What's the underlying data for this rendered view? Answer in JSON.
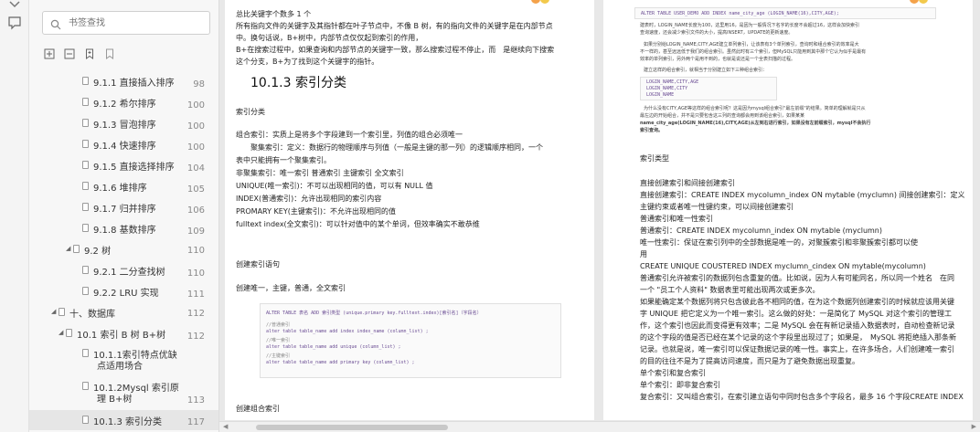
{
  "outline": {
    "search_placeholder": "书签查找",
    "items": [
      {
        "label": "9.1.1 直接插入排序",
        "page": "98",
        "level": 2
      },
      {
        "label": "9.1.2 希尔排序",
        "page": "100",
        "level": 2
      },
      {
        "label": "9.1.3 冒泡排序",
        "page": "100",
        "level": 2
      },
      {
        "label": "9.1.4 快速排序",
        "page": "100",
        "level": 2
      },
      {
        "label": "9.1.5 直接选择排序",
        "page": "104",
        "level": 2
      },
      {
        "label": "9.1.6 堆排序",
        "page": "105",
        "level": 2
      },
      {
        "label": "9.1.7 归并排序",
        "page": "106",
        "level": 2
      },
      {
        "label": "9.1.8 基数排序",
        "page": "109",
        "level": 2
      },
      {
        "label": "9.2 树",
        "page": "110",
        "level": 1
      },
      {
        "label": "9.2.1 二分查找树",
        "page": "110",
        "level": 2
      },
      {
        "label": "9.2.2 LRU 实现",
        "page": "111",
        "level": 2
      },
      {
        "label": "十、数据库",
        "page": "112",
        "level": 0
      },
      {
        "label": "10.1 索引 B 树 B+树",
        "page": "112",
        "level": 1
      },
      {
        "label": "10.1.1索引特点优缺",
        "label2": "点适用场合",
        "page": "",
        "level": 2
      },
      {
        "label": "10.1.2Mysql 索引原",
        "label2": "理 B+树",
        "page": "113",
        "level": 2
      },
      {
        "label": "10.1.3 索引分类",
        "page": "117",
        "level": 2
      }
    ]
  },
  "page1": {
    "lines_top": [
      "总比关键字个数多 1 个",
      "所有指向文件的关键字及其指针都在叶子节点中，不像 B 树，有的指向文件的关键字是在内部节点",
      "中。换句话说，B+树中，内部节点仅仅起到索引的作用，",
      "B+在搜索过程中，如果查询和内部节点的关键字一致，那么搜索过程不停止，而　是继续向下搜索",
      "这个分支，B+为了找到这个关键字的指针。"
    ],
    "heading": "10.1.3 索引分类",
    "section1": "索引分类",
    "lines_mid": [
      "组合索引：实质上是将多个字段建到一个索引里，列值的组合必须唯一",
      "　　聚集索引：定义：数据行的物理顺序与列值（一般是主键的那一列）的逻辑顺序相同，一个",
      "表中只能拥有一个聚集索引。",
      "非聚集索引：唯一索引 普通索引 主键索引 全文索引",
      "UNIQUE(唯一索引)：不可以出现相同的值，可以有 NULL 值",
      "INDEX(普通索引)：允许出现相同的索引内容",
      "PROMARY KEY(主键索引)：不允许出现相同的值",
      "fulltext index(全文索引)：可以针对值中的某个单词，但效率确实不敢恭维"
    ],
    "section2": "创建索引语句",
    "section3": "创建唯一，主键，普通，全文索引",
    "code": [
      "ALTER TABLE 表名 ADD 索引类型 (unique.primary key.fulltext.index)[索引名]（字段名）",
      "//普通索引",
      "alter table table_name add index index_name (column_list) ;",
      "//唯一索引",
      "alter table table_name add unique (column_list) ;",
      "//主键索引",
      "alter table table_name add primary key (column_list) ;"
    ],
    "section4": "创建组合索引"
  },
  "page2": {
    "code_top": "ALTER TABLE USER_DEMO ADD INDEX name_city_age (LOGIN_NAME(16),CITY,AGE);",
    "small_lines": [
      "建表时，LOGIN_NAME长度为100，这里用16，是因为一般情况下名字的长度不会超过16，这样会加快索引",
      "查询速度，还会减少索引文件的大小，提高INSERT，UPDATE的更新速度。",
      "如果分别给LOGIN_NAME,CITY,AGE建立单列索引，让该表有3个单列索引，查询时和组合索引的效率是大",
      "不一样的，甚至远远低于我们的组合索引。虽然此时有三个索引，但MySQL只能用到其中那个它认为似乎是最有",
      "效率的单列索引，另外两个是用不到的，也就是说还是一个全表扫描的过程。",
      "建立这样的组合索引，就相当于分别建立如下三种组合索引：",
      "LOGIN_NAME,CITY,AGE",
      "LOGIN_NAME,CITY",
      "LOGIN_NAME",
      "为什么没有CITY,AGE等这样的组合索引呢？这是因为mysql组合索引\"最左前缀\"的结果。简单的理解就是只从",
      "最左边的开始组合，并不是只要包含这三列的查询都会用到该组合索引，如果某某",
      "name_city_age(LOGIN_NAME(16),CITY,AGE)从左到右进行索引，如果没有左前缀索引，mysql不会执行",
      "索引查询。"
    ],
    "section1": "索引类型",
    "lines": [
      "直接创建索引和间接创建索引",
      "直接创建索引：CREATE INDEX mycolumn_index ON mytable (myclumn) 间接创建索引：定义",
      "主键约束或者唯一性键约束，可以间接创建索引",
      "普通索引和唯一性索引",
      "普通索引：CREATE INDEX mycolumn_index ON mytable (myclumn)",
      "唯一性索引：保证在索引列中的全部数据是唯一的，对聚簇索引和非聚簇索引都可以使",
      "用",
      "CREATE UNIQUE COUSTERED INDEX myclumn_cindex ON mytable(mycolumn)",
      "普通索引允许被索引的数据列包含重复的值。比如说，因为人有可能同名，所以同一个姓名　在同",
      "一个 \"员工个人资料\" 数据表里可能出现两次或更多次。",
      "如果能确定某个数据列将只包含彼此各不相同的值，在为这个数据列创建索引的时候就应该用关键",
      "字 UNIQUE 把它定义为一个唯一索引。这么做的好处：一是简化了 MySQL 对这个索引的管理工",
      "作，这个索引也因此而变得更有效率；二是 MySQL 会在有新记录插入数据表时，自动检查新记录",
      "的这个字段的值是否已经在某个记录的这个字段里出现过了；如果是，　MySQL 将拒绝插入那条新",
      "记录。也就是说，唯一索引可以保证数据记录的唯一性。事实上，在许多场合，人们创建唯一索引",
      "的目的往往不是为了提高访问速度，而只是为了避免数据出现重复。",
      "单个索引和复合索引",
      "单个索引：即非复合索引",
      "复合索引：又叫组合索引，在索引建立语句中同时包含多个字段名，最多 16 个字段CREATE INDEX"
    ]
  },
  "colors": {
    "accent_red": "#d33333",
    "code_purple": "#6a4c93"
  }
}
